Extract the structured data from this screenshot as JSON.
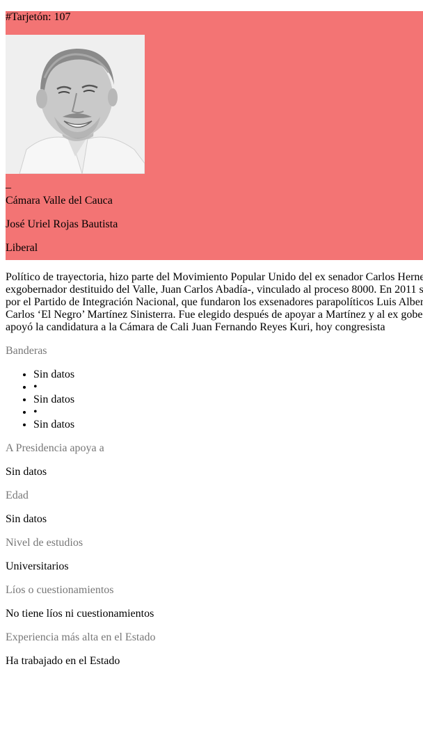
{
  "card": {
    "tarjeton": "#Tarjetón: 107",
    "underscore": "_",
    "corporation": "Cámara Valle del Cauca",
    "name": "José Uriel Rojas Bautista",
    "party": "Liberal",
    "accent_color": "#f37474"
  },
  "description_lines": [
    "Político de trayectoria, hizo parte del Movimiento Popular Unido del ex senador Carlos Herne",
    "exgobernador destituido del Valle, Juan Carlos Abadía-, vinculado al proceso 8000. En 2011 s",
    "por el Partido de Integración Nacional, que fundaron los exsenadores parapolíticos Luis Alber",
    "Carlos ‘El Negro’ Martínez Sinisterra. Fue elegido después de apoyar a Martínez y al ex gobe",
    "apoyó la candidatura a la Cámara de Cali Juan Fernando Reyes Kuri, hoy congresista"
  ],
  "banderas": {
    "label": "Banderas",
    "items": [
      "Sin datos",
      "•",
      "Sin datos",
      "•",
      "Sin datos"
    ]
  },
  "presidencia": {
    "label": "A Presidencia apoya a",
    "value": "Sin datos"
  },
  "edad": {
    "label": "Edad",
    "value": "Sin datos"
  },
  "estudios": {
    "label": "Nivel de estudios",
    "value": "Universitarios"
  },
  "lios": {
    "label": "Líos o cuestionamientos",
    "value": "No tiene líos ni cuestionamientos"
  },
  "experiencia": {
    "label": "Experiencia más alta en el Estado",
    "value": "Ha trabajado en el Estado"
  }
}
